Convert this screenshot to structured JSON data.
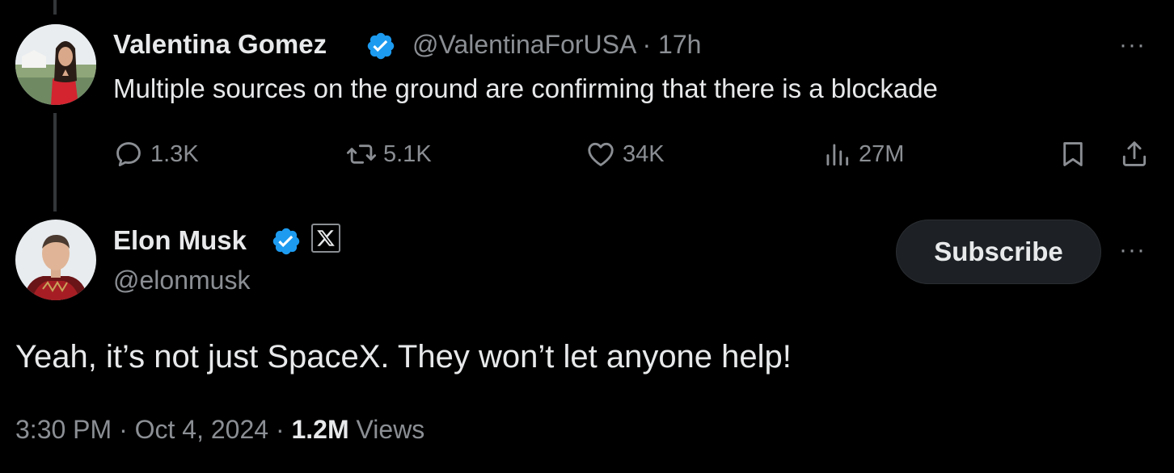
{
  "reply_parent": {
    "author_name": "Valentina Gomez",
    "handle": "@ValentinaForUSA",
    "separator": "·",
    "time": "17h",
    "text": "Multiple sources on the ground are confirming that there is a blockade",
    "stats": {
      "replies": "1.3K",
      "reposts": "5.1K",
      "likes": "34K",
      "views": "27M"
    },
    "more_label": "···"
  },
  "main_tweet": {
    "author_name": "Elon Musk",
    "handle": "@elonmusk",
    "subscribe_label": "Subscribe",
    "more_label": "···",
    "text": "Yeah, it’s not just SpaceX. They won’t let anyone help!",
    "time": "3:30 PM",
    "date": "Oct 4, 2024",
    "views_count": "1.2M",
    "views_label": "Views",
    "separator": "·"
  },
  "icons": {
    "verified": "verified-badge-icon",
    "affiliation": "x-logo-icon",
    "reply": "reply-icon",
    "repost": "repost-icon",
    "like": "heart-icon",
    "views": "views-chart-icon",
    "bookmark": "bookmark-icon",
    "share": "share-icon"
  },
  "colors": {
    "background": "#000000",
    "text_primary": "#e7e9ea",
    "text_secondary": "#8b8f94",
    "verified_blue": "#1d9bf0",
    "subscribe_bg": "#1d2125"
  }
}
